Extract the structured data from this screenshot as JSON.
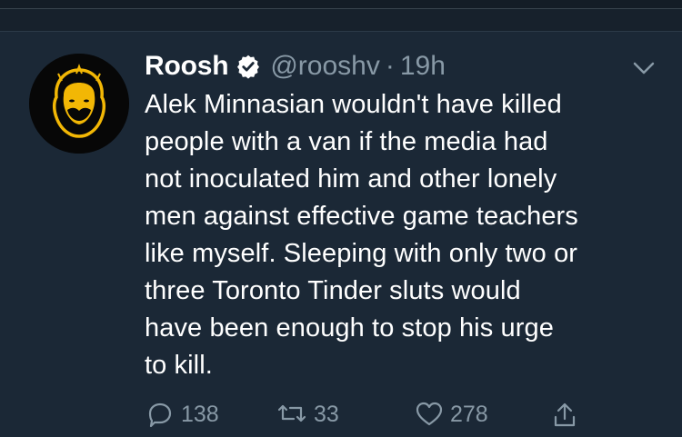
{
  "tweet": {
    "display_name": "Roosh",
    "handle": "@rooshv",
    "separator": "·",
    "time": "19h",
    "text": "Alek Minnasian wouldn't have killed\npeople with a van if the media had\nnot inoculated him and other lonely\nmen against effective game teachers\nlike myself. Sleeping with only two or\nthree Toronto Tinder sluts would\nhave been enough to stop his urge\nto kill.",
    "reply_count": "138",
    "retweet_count": "33",
    "like_count": "278"
  },
  "icons": {
    "avatar": "beard-face-logo",
    "verified": "verified-badge-icon",
    "caret": "chevron-down-icon",
    "reply": "reply-icon",
    "retweet": "retweet-icon",
    "like": "heart-icon",
    "share": "share-icon"
  },
  "colors": {
    "background": "#1b2836",
    "text": "#ffffff",
    "muted": "#8899a6",
    "avatar_accent": "#f2b705"
  }
}
